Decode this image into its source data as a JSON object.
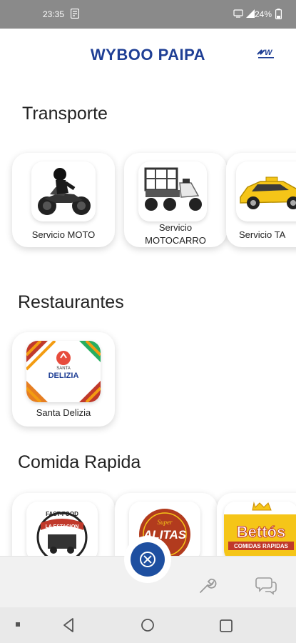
{
  "status_bar": {
    "time": "23:35",
    "battery": "24%"
  },
  "header": {
    "title": "WYBOO PAIPA"
  },
  "sections": {
    "transporte": {
      "title": "Transporte",
      "items": [
        {
          "label": "Servicio MOTO"
        },
        {
          "label": "Servicio\nMOTOCARRO"
        },
        {
          "label": "Servicio TA"
        }
      ]
    },
    "restaurantes": {
      "title": "Restaurantes",
      "items": [
        {
          "label": "Santa Delizia"
        }
      ]
    },
    "comida_rapida": {
      "title": "Comida Rapida",
      "items": [
        {
          "label": ""
        },
        {
          "label": ""
        },
        {
          "label": ""
        }
      ]
    }
  },
  "logos": {
    "santa_delizia": {
      "top_text": "SANTA",
      "name": "DELIZIA"
    },
    "fast_food": {
      "top_text": "FAST-FOOD",
      "name": "LA ESTACION"
    },
    "super_alitas": {
      "top_text": "Super",
      "name": "ALITAS"
    },
    "bettos": {
      "name": "Bettós",
      "subtitle": "COMIDAS RAPIDAS"
    }
  },
  "colors": {
    "brand_blue": "#1f3f95",
    "fab_blue": "#1e4fa0",
    "status_bar": "#8a8a8a"
  },
  "icons": {
    "fab": "close-circle-icon",
    "tools": "wrench-icon",
    "chat": "chat-bubbles-icon"
  }
}
